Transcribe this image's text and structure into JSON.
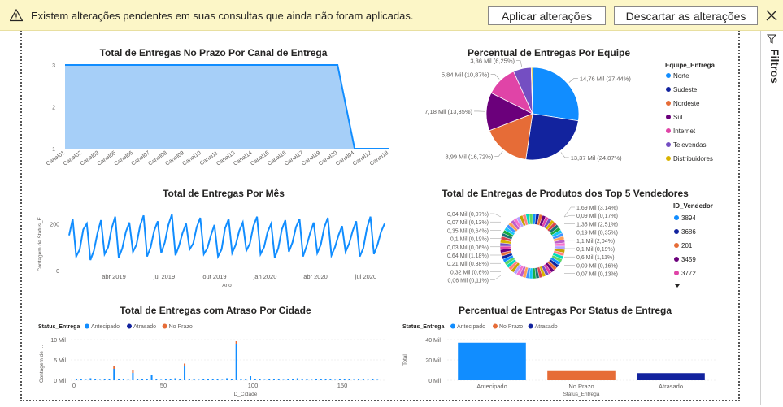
{
  "banner": {
    "message": "Existem alterações pendentes em suas consultas que ainda não foram aplicadas.",
    "apply_label": "Aplicar alterações",
    "discard_label": "Descartar as alterações"
  },
  "filters_pane": {
    "label": "Filtros"
  },
  "colors": {
    "banner_bg": "#FCF6C7",
    "area_fill": "#A6CFF8",
    "area_line": "#118DFF",
    "series_blue": "#118DFF",
    "series_navy": "#12239E",
    "series_orange": "#E66C37",
    "series_purple": "#6B007B",
    "series_pink": "#E044A7",
    "series_violet": "#744EC2",
    "series_gold": "#D9B300"
  },
  "visuals": [
    {
      "title": "Total de Entregas No Prazo Por Canal de Entrega",
      "chart_data": {
        "type": "area",
        "categories": [
          "Canal01",
          "Canal02",
          "Canal03",
          "Canal05",
          "Canal06",
          "Canal07",
          "Canal08",
          "Canal09",
          "Canal10",
          "Canal11",
          "Canal13",
          "Canal14",
          "Canal15",
          "Canal16",
          "Canal17",
          "Canal19",
          "Canal20",
          "Canal04",
          "Canal12",
          "Canal18"
        ],
        "values": [
          3,
          3,
          3,
          3,
          3,
          3,
          3,
          3,
          3,
          3,
          3,
          3,
          3,
          3,
          3,
          3,
          3,
          1,
          1,
          1
        ],
        "ylim": [
          1,
          3
        ],
        "yticks": [
          "1",
          "2",
          "3"
        ]
      }
    },
    {
      "title": "Percentual de Entregas Por Equipe",
      "chart_data": {
        "type": "pie",
        "legend_title": "Equipe_Entrega",
        "slices": [
          {
            "name": "Norte",
            "value": 14.76,
            "label": "14,76 Mil (27,44%)",
            "color": "#118DFF"
          },
          {
            "name": "Sudeste",
            "value": 13.37,
            "label": "13,37 Mil (24,87%)",
            "color": "#12239E"
          },
          {
            "name": "Nordeste",
            "value": 8.99,
            "label": "8,99 Mil (16,72%)",
            "color": "#E66C37"
          },
          {
            "name": "Sul",
            "value": 7.18,
            "label": "7,18 Mil (13,35%)",
            "color": "#6B007B"
          },
          {
            "name": "Internet",
            "value": 5.84,
            "label": "5,84 Mil (10,87%)",
            "color": "#E044A7"
          },
          {
            "name": "Televendas",
            "value": 3.36,
            "label": "3,36 Mil (6,25%)",
            "color": "#744EC2"
          },
          {
            "name": "Distribuidores",
            "value": 0.25,
            "label": "",
            "color": "#D9B300"
          }
        ]
      }
    },
    {
      "title": "Total de Entregas Por Mês",
      "chart_data": {
        "type": "line",
        "xlabel": "Ano",
        "ylabel": "Contagem de Status_E...",
        "yticks": [
          "0",
          "200"
        ],
        "xticks": [
          "abr 2019",
          "jul 2019",
          "out 2019",
          "jan 2020",
          "abr 2020",
          "jul 2020"
        ],
        "ylim": [
          0,
          260
        ],
        "series": [
          {
            "values": [
              150,
              220,
              60,
              90,
              175,
              200,
              45,
              85,
              160,
              215,
              70,
              100,
              180,
              230,
              55,
              95,
              165,
              205,
              80,
              110,
              190,
              235,
              60,
              100,
              170,
              210,
              75,
              120,
              195,
              240,
              65,
              105,
              160,
              200,
              90,
              115,
              185,
              225,
              70,
              95,
              150,
              195,
              60,
              90,
              180,
              220,
              75,
              110,
              170,
              205,
              85,
              115,
              190,
              230,
              70,
              100,
              165,
              200,
              55,
              95,
              175,
              215,
              80,
              120,
              185,
              220,
              60,
              105,
              160,
              205,
              75,
              110,
              185,
              225,
              65,
              100,
              150,
              190,
              80,
              115,
              170,
              210,
              60,
              95,
              180,
              230,
              70,
              110,
              165,
              200
            ]
          }
        ]
      }
    },
    {
      "title": "Total de Entregas de Produtos dos Top 5 Vendedores",
      "chart_data": {
        "type": "pie",
        "legend_title": "ID_Vendedor",
        "legend": [
          {
            "name": "3894",
            "color": "#118DFF"
          },
          {
            "name": "3686",
            "color": "#12239E"
          },
          {
            "name": "201",
            "color": "#E66C37"
          },
          {
            "name": "3459",
            "color": "#6B007B"
          },
          {
            "name": "3772",
            "color": "#E044A7"
          }
        ],
        "labels_left": [
          "0,04 Mil (0,07%)",
          "0,07 Mil (0,13%)",
          "0,35 Mil (0,64%)",
          "0,1 Mil (0,19%)",
          "0,03 Mil (0,06%)",
          "0,64 Mil (1,18%)",
          "0,21 Mil (0,38%)",
          "0,32 Mil (0,6%)",
          "0,06 Mil (0,11%)"
        ],
        "labels_right": [
          "1,69 Mil (3,14%)",
          "0,09 Mil (0,17%)",
          "1,35 Mil (2,51%)",
          "0,19 Mil (0,35%)",
          "1,1 Mil (2,04%)",
          "0,1 Mil (0,19%)",
          "0,6 Mil (1,11%)",
          "0,09 Mil (0,16%)",
          "0,07 Mil (0,13%)"
        ]
      }
    },
    {
      "title": "Total de Entregas com Atraso Por Cidade",
      "chart_data": {
        "type": "bar",
        "legend_title": "Status_Entrega",
        "series": [
          {
            "name": "Antecipado",
            "color": "#118DFF"
          },
          {
            "name": "Atrasado",
            "color": "#12239E"
          },
          {
            "name": "No Prazo",
            "color": "#E66C37"
          }
        ],
        "xlabel": "ID_Cidade",
        "ylabel": "Contagem de ...",
        "yticks": [
          "0 Mil",
          "5 Mil",
          "10 Mil"
        ],
        "xticks": [
          "0",
          "50",
          "100",
          "150"
        ],
        "ylim": [
          0,
          10
        ]
      }
    },
    {
      "title": "Percentual de Entregas Por Status de Entrega",
      "chart_data": {
        "type": "bar",
        "legend_title": "Status_Entrega",
        "categories": [
          "Antecipado",
          "No Prazo",
          "Atrasado"
        ],
        "values": [
          37,
          9,
          7
        ],
        "colors": [
          "#118DFF",
          "#E66C37",
          "#12239E"
        ],
        "xlabel": "Status_Entrega",
        "ylabel": "Total",
        "yticks": [
          "0 Mil",
          "20 Mil",
          "40 Mil"
        ],
        "ylim": [
          0,
          40
        ]
      }
    }
  ]
}
